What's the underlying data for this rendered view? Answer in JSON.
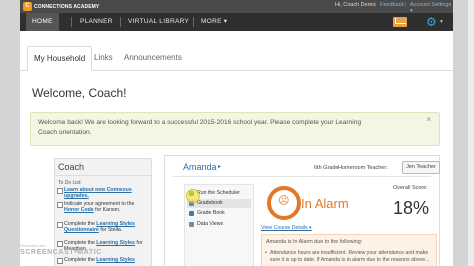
{
  "app": {
    "logo_text": "CONNECTIONS ACADEMY"
  },
  "nav": {
    "items": [
      "HOME",
      "PLANNER",
      "VIRTUAL LIBRARY",
      "MORE ▾"
    ],
    "greeting": "Hi, Coach Demo",
    "feedback": "Feedback",
    "account_settings": "Account Settings ▾"
  },
  "tabs": [
    "My Household",
    "Links",
    "Announcements"
  ],
  "welcome": "Welcome, Coach!",
  "notice": {
    "text": "Welcome back! We are looking forward to a successful 2015-2016 school year. Please complete your Learning Coach orientation.",
    "close": "×"
  },
  "coach": {
    "title": "Coach",
    "todo_header": "To Do List:",
    "items": [
      {
        "link": "Learn about new Connexus upgrades.",
        "text": ""
      },
      {
        "link": "",
        "text": "Indicate your agreement to the ",
        "link2": "Honor Code",
        "text2": " for Karson."
      },
      {
        "link": "",
        "text": "Complete the ",
        "link2": "Learning Styles Questionnaire",
        "text2": " for Stella."
      },
      {
        "link": "",
        "text": "Complete the ",
        "link2": "Learning Styles",
        "text2": " for Meaghan."
      },
      {
        "link": "",
        "text": "Complete the ",
        "link2": "Learning Styles",
        "text2": ""
      }
    ]
  },
  "student": {
    "name": "Amanda",
    "arrow": "▸",
    "grade": "6th Grade",
    "homeroom_label": "Homeroom Teacher:",
    "teacher_button": "Jen Teacher",
    "menu": [
      "Run the Scheduler",
      "Gradebook",
      "Grade Book",
      "Data Views"
    ],
    "status": "In Alarm",
    "score_label": "Overall Score:",
    "score_value": "18%",
    "view_course_details": "View Course Details ▾",
    "info_line1": "Amanda is In Alarm due to the following:",
    "info_line2": "Attendance hours are insufficient. Review your attendance and make sure it is up to date. If Amanda is in alarm due to the reasons above..."
  },
  "watermark": {
    "small": "Recorded with",
    "big": "SCREENCAST•MATIC"
  },
  "colors": {
    "accent_orange": "#e07a2a",
    "link_blue": "#2a6fa8",
    "nav_dark": "#2f2f2f"
  }
}
